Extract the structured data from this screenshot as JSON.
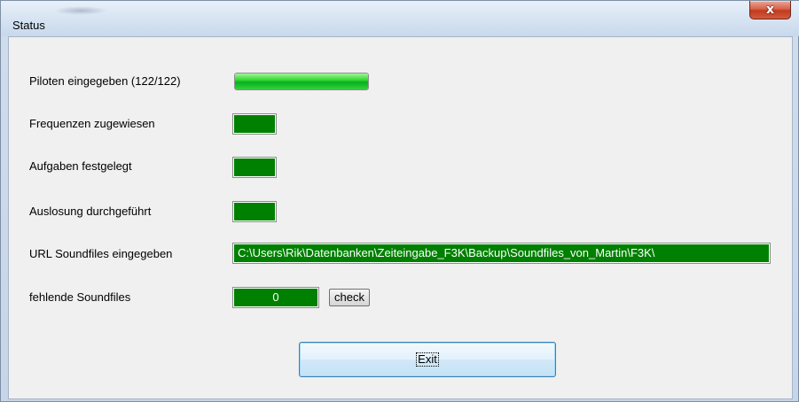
{
  "window": {
    "title": "Status",
    "close_glyph": "x"
  },
  "rows": {
    "piloten": {
      "label": "Piloten eingegeben (122/122)",
      "progress_fraction": 1.0
    },
    "frequenzen": {
      "label": "Frequenzen zugewiesen",
      "status_color": "#008000"
    },
    "aufgaben": {
      "label": "Aufgaben festgelegt",
      "status_color": "#008000"
    },
    "auslosung": {
      "label": "Auslosung durchgeführt",
      "status_color": "#008000"
    },
    "url": {
      "label": "URL Soundfiles eingegeben",
      "value": "C:\\Users\\Rik\\Datenbanken\\Zeiteingabe_F3K\\Backup\\Soundfiles_von_Martin\\F3K\\"
    },
    "fehlende": {
      "label": "fehlende Soundfiles",
      "count": "0",
      "check_label": "check"
    }
  },
  "buttons": {
    "exit_label": "Exit"
  },
  "colors": {
    "status_green": "#008000",
    "progress_green": "#06b025",
    "close_red": "#c23b1e"
  }
}
